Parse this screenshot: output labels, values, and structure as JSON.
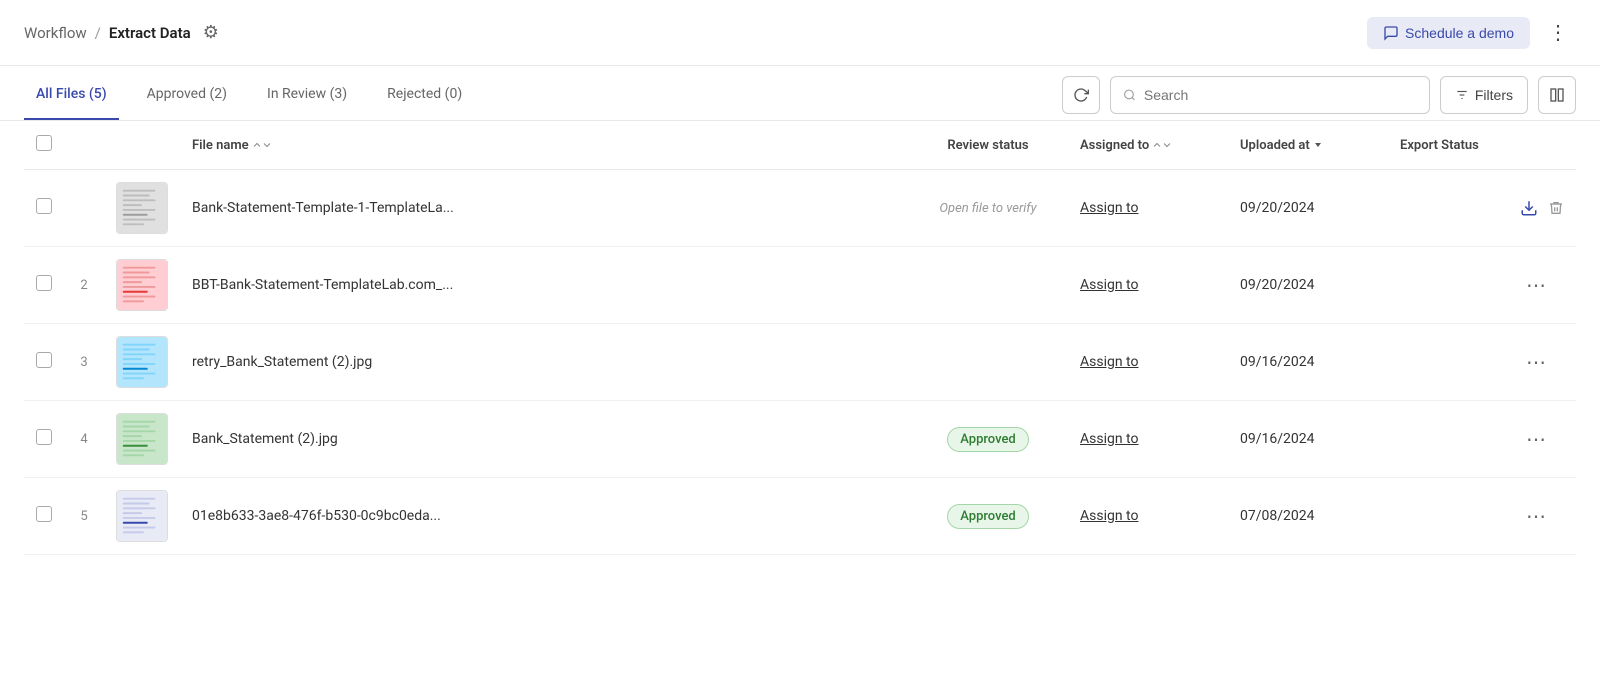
{
  "header": {
    "breadcrumb_workflow": "Workflow",
    "breadcrumb_sep": "/",
    "breadcrumb_current": "Extract Data",
    "gear_icon": "⚙",
    "schedule_demo_label": "Schedule a demo",
    "chat_icon": "💬",
    "more_icon": "⋮"
  },
  "tabs": [
    {
      "id": "all",
      "label": "All Files (5)",
      "active": true
    },
    {
      "id": "approved",
      "label": "Approved (2)",
      "active": false
    },
    {
      "id": "inreview",
      "label": "In Review (3)",
      "active": false
    },
    {
      "id": "rejected",
      "label": "Rejected (0)",
      "active": false
    }
  ],
  "toolbar": {
    "refresh_icon": "↻",
    "search_placeholder": "Search",
    "filters_label": "Filters",
    "filter_icon": "≡",
    "columns_icon": "⊞"
  },
  "table": {
    "columns": [
      {
        "id": "check",
        "label": ""
      },
      {
        "id": "num",
        "label": ""
      },
      {
        "id": "thumb",
        "label": ""
      },
      {
        "id": "name",
        "label": "File name",
        "sortable": true
      },
      {
        "id": "status",
        "label": "Review status"
      },
      {
        "id": "assign",
        "label": "Assigned to",
        "sortable": true
      },
      {
        "id": "upload",
        "label": "Uploaded at",
        "sortable": true,
        "sort_active": true
      },
      {
        "id": "export",
        "label": "Export Status"
      },
      {
        "id": "actions",
        "label": ""
      }
    ],
    "rows": [
      {
        "id": 1,
        "num": "",
        "name": "Bank-Statement-Template-1-TemplateLa...",
        "review_status": "Open file to verify",
        "review_type": "open",
        "assign_label": "Assign to",
        "upload_date": "09/20/2024",
        "export_status": "",
        "has_download": true,
        "has_delete": true
      },
      {
        "id": 2,
        "num": "2",
        "name": "BBT-Bank-Statement-TemplateLab.com_...",
        "review_status": "",
        "review_type": "none",
        "assign_label": "Assign to",
        "upload_date": "09/20/2024",
        "export_status": "",
        "has_download": false,
        "has_delete": false
      },
      {
        "id": 3,
        "num": "3",
        "name": "retry_Bank_Statement (2).jpg",
        "review_status": "",
        "review_type": "none",
        "assign_label": "Assign to",
        "upload_date": "09/16/2024",
        "export_status": "",
        "has_download": false,
        "has_delete": false
      },
      {
        "id": 4,
        "num": "4",
        "name": "Bank_Statement (2).jpg",
        "review_status": "Approved",
        "review_type": "approved",
        "assign_label": "Assign to",
        "upload_date": "09/16/2024",
        "export_status": "",
        "has_download": false,
        "has_delete": false
      },
      {
        "id": 5,
        "num": "5",
        "name": "01e8b633-3ae8-476f-b530-0c9bc0eda...",
        "review_status": "Approved",
        "review_type": "approved",
        "assign_label": "Assign to",
        "upload_date": "07/08/2024",
        "export_status": "",
        "has_download": false,
        "has_delete": false
      }
    ]
  }
}
